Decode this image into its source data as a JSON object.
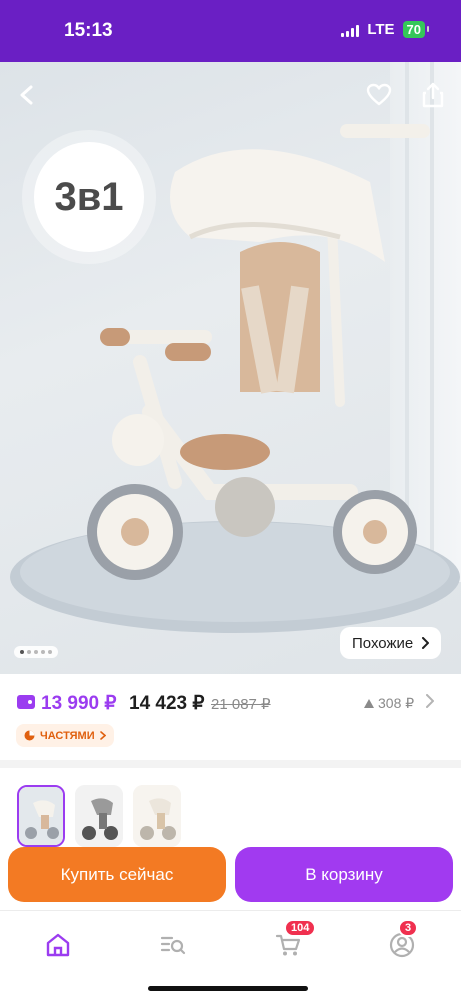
{
  "status_bar": {
    "time": "15:13",
    "network": "LTE",
    "battery": "70"
  },
  "hero": {
    "badge": "3в1",
    "similar_label": "Похожие",
    "page_count": 5,
    "active_page": 1
  },
  "price": {
    "card_price": "13 990 ₽",
    "price": "14 423 ₽",
    "old_price": "21 087 ₽",
    "reviews": "308 ₽",
    "installments": "ЧАСТЯМИ"
  },
  "actions": {
    "buy_now": "Купить сейчас",
    "add_to_cart": "В корзину"
  },
  "tabbar": {
    "cart_count": "104",
    "profile_count": "3"
  },
  "colors": {
    "brand": "#6a1fc4",
    "accent": "#9b3cf0",
    "buy": "#f37a23",
    "cart": "#a13af0",
    "badge": "#f0304f"
  }
}
